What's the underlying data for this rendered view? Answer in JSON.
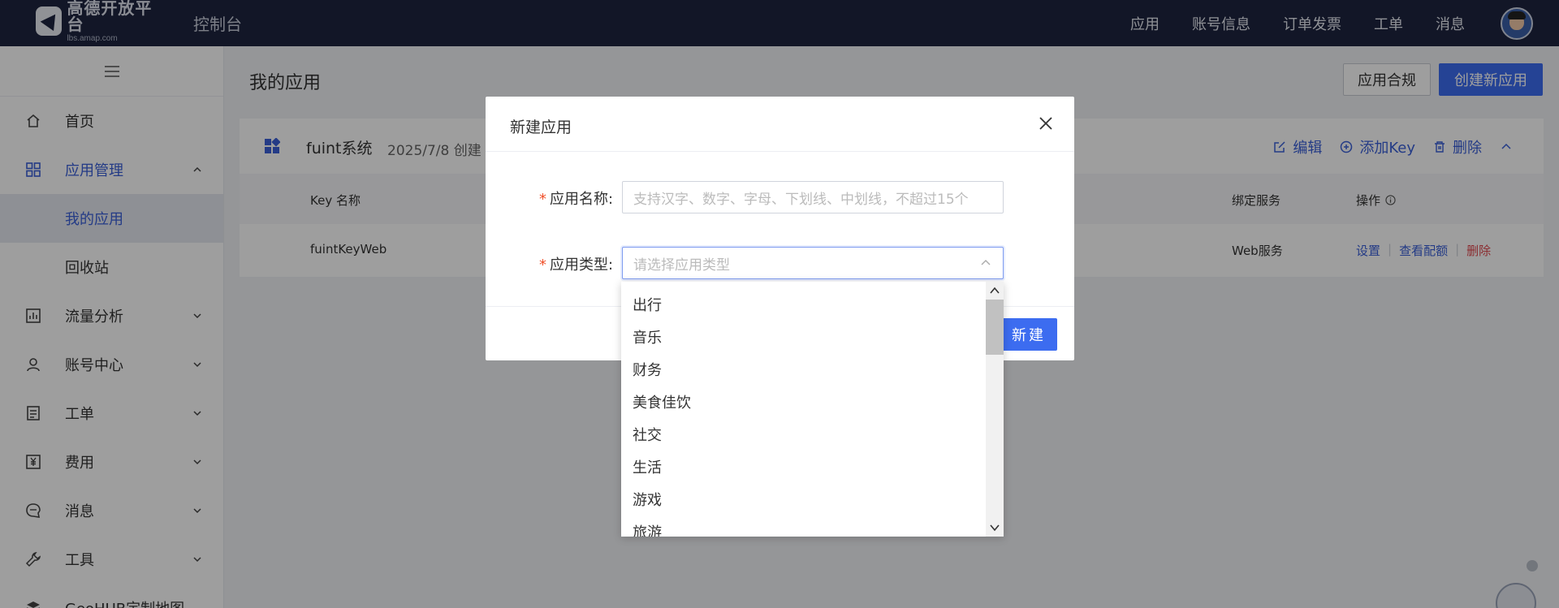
{
  "topbar": {
    "logo_title": "高德开放平台",
    "logo_sub": "lbs.amap.com",
    "console": "控制台",
    "nav": [
      "应用",
      "账号信息",
      "订单发票",
      "工单",
      "消息"
    ]
  },
  "sidebar": {
    "items": {
      "home": "首页",
      "app_mgmt": "应用管理",
      "my_apps": "我的应用",
      "recycle": "回收站",
      "traffic": "流量分析",
      "account": "账号中心",
      "ticket": "工单",
      "fee": "费用",
      "message": "消息",
      "tools": "工具",
      "geohub": "GeoHUB定制地图"
    }
  },
  "main": {
    "title": "我的应用",
    "compliance_btn": "应用合规",
    "create_btn": "创建新应用",
    "app": {
      "name": "fuint系统",
      "date": "2025/7/8 创建",
      "actions": {
        "edit": "编辑",
        "add_key": "添加Key",
        "delete": "删除"
      },
      "table": {
        "headers": {
          "key_name": "Key 名称",
          "service": "绑定服务",
          "ops": "操作"
        },
        "row": {
          "key_name": "fuintKeyWeb",
          "service": "Web服务",
          "ops": {
            "settings": "设置",
            "quota": "查看配额",
            "delete": "删除"
          }
        }
      }
    }
  },
  "modal": {
    "title": "新建应用",
    "name_label": "应用名称:",
    "name_placeholder": "支持汉字、数字、字母、下划线、中划线，不超过15个",
    "type_label": "应用类型:",
    "type_placeholder": "请选择应用类型",
    "submit": "新建"
  },
  "dropdown": {
    "options": [
      "出行",
      "音乐",
      "财务",
      "美食佳饮",
      "社交",
      "生活",
      "游戏",
      "旅游"
    ]
  }
}
